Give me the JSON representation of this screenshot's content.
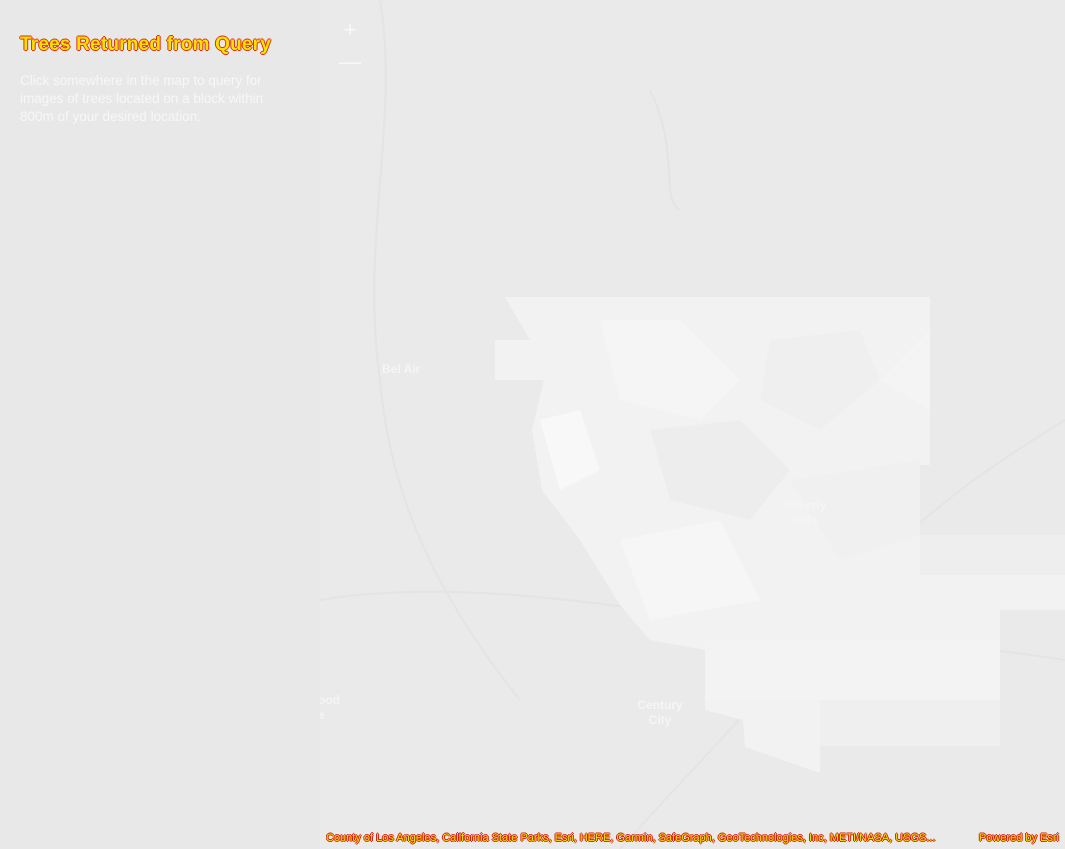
{
  "panel": {
    "title": "Trees Returned from Query",
    "description": "Click somewhere in the map to query for images of trees located on a block within 800m of your desired location."
  },
  "map": {
    "zoom_in_icon": "plus-icon",
    "zoom_out_icon": "minus-icon",
    "zoom_in_label": "+",
    "zoom_out_label": "—",
    "places": {
      "bel_air": "Bel Air",
      "beverly_hills": "Beverly Hills",
      "century_city": "Century City",
      "westwood": "ood e"
    }
  },
  "attribution": {
    "text": "County of Los Angeles, California State Parks, Esri, HERE, Garmin, SafeGraph, GeoTechnologies, Inc, METI/NASA, USGS...",
    "powered": "Powered by Esri"
  },
  "colors": {
    "title_fill": "#f6e200",
    "title_outline": "#e02a10",
    "basemap": "#eaeaea",
    "polygon_light": "#f7f7f7"
  }
}
